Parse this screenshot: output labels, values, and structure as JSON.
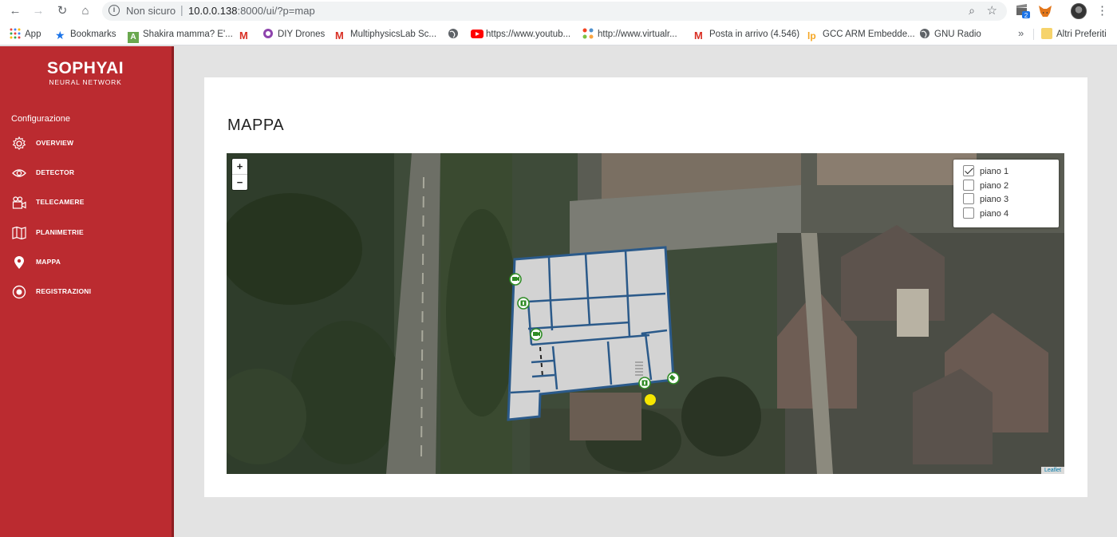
{
  "browser": {
    "insecure_label": "Non sicuro",
    "url_host": "10.0.0.138",
    "url_rest": ":8000/ui/?p=map",
    "extension_badge": "2"
  },
  "bookmarks": [
    {
      "label": "App"
    },
    {
      "label": "Bookmarks"
    },
    {
      "label": "Shakira mamma? E'..."
    },
    {
      "label": ""
    },
    {
      "label": "DIY Drones"
    },
    {
      "label": "MultiphysicsLab Sc..."
    },
    {
      "label": ""
    },
    {
      "label": "https://www.youtub..."
    },
    {
      "label": "http://www.virtualr..."
    },
    {
      "label": "Posta in arrivo (4.546)"
    },
    {
      "label": "GCC ARM Embedde..."
    },
    {
      "label": "GNU Radio"
    }
  ],
  "bookmarks_more": "»",
  "bookmarks_other": "Altri Preferiti",
  "sidebar": {
    "logo_title": "SOPHYAI",
    "logo_subtitle": "NEURAL NETWORK",
    "section_label": "Configurazione",
    "items": [
      {
        "label": "OVERVIEW",
        "icon": "gear-icon"
      },
      {
        "label": "DETECTOR",
        "icon": "eye-icon"
      },
      {
        "label": "TELECAMERE",
        "icon": "video-camera-icon"
      },
      {
        "label": "PLANIMETRIE",
        "icon": "map-icon"
      },
      {
        "label": "MAPPA",
        "icon": "map-pin-icon"
      },
      {
        "label": "REGISTRAZIONI",
        "icon": "record-icon"
      }
    ]
  },
  "main": {
    "title": "MAPPA",
    "zoom_in": "+",
    "zoom_out": "−",
    "layers": [
      {
        "label": "piano 1",
        "checked": true
      },
      {
        "label": "piano 2",
        "checked": false
      },
      {
        "label": "piano 3",
        "checked": false
      },
      {
        "label": "piano 4",
        "checked": false
      }
    ],
    "attribution": "Leaflet"
  },
  "colors": {
    "sidebar_bg": "#bb2b30",
    "floorplan_fill": "#d3d3d3",
    "floorplan_stroke": "#2b5a8a",
    "marker_green": "#2e8b24",
    "position_dot": "#f5e600"
  }
}
